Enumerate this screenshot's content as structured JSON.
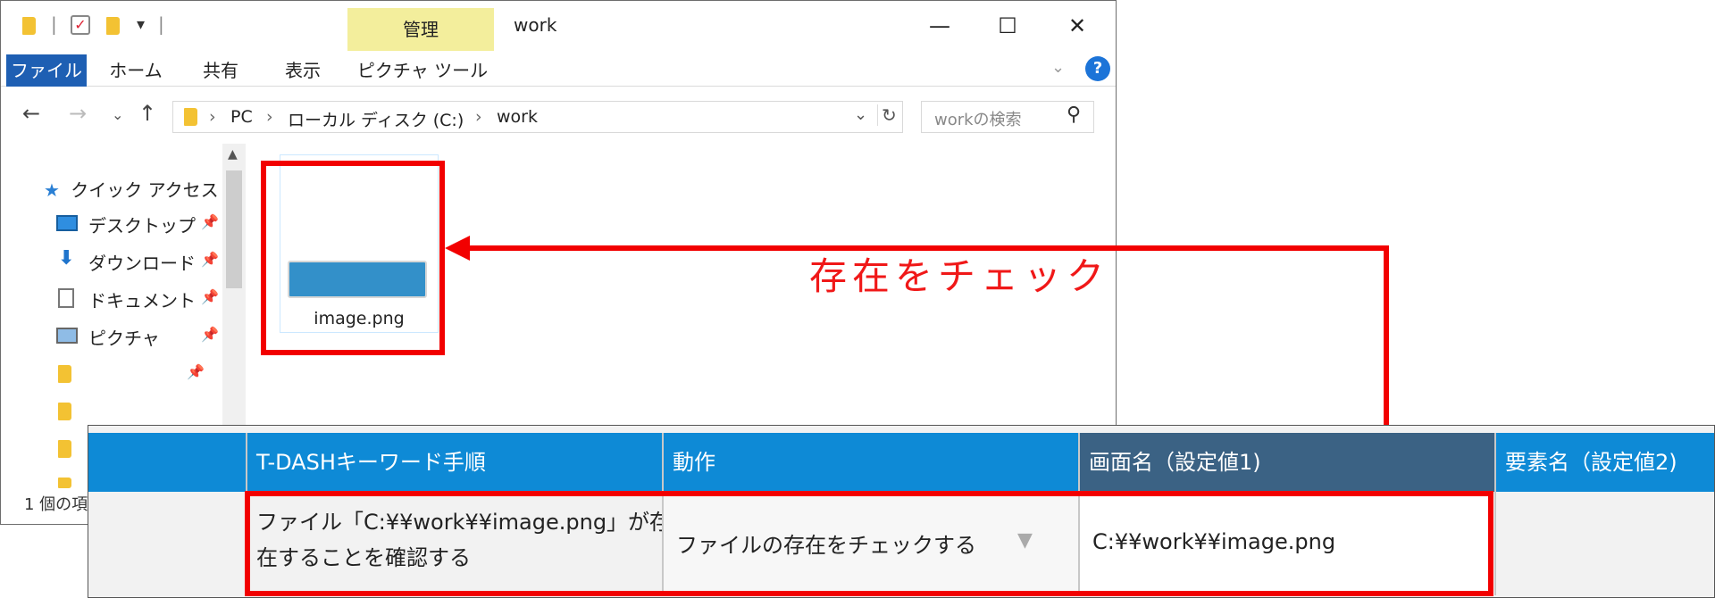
{
  "explorer": {
    "title": "work",
    "context_tab": "管理",
    "ribbon_tabs": [
      "ファイル",
      "ホーム",
      "共有",
      "表示",
      "ピクチャ ツール"
    ],
    "address": {
      "segments": [
        "PC",
        "ローカル ディスク (C:)",
        "work"
      ]
    },
    "search_placeholder": "workの検索",
    "nav": {
      "quick_access": "クイック アクセス",
      "items": [
        {
          "label": "デスクトップ",
          "icon": "desktop-icon"
        },
        {
          "label": "ダウンロード",
          "icon": "download-arrow-icon"
        },
        {
          "label": "ドキュメント",
          "icon": "document-icon"
        },
        {
          "label": "ピクチャ",
          "icon": "picture-icon"
        }
      ]
    },
    "file": {
      "name": "image.png"
    },
    "status": "1 個の項"
  },
  "annotation": {
    "label": "存在をチェック",
    "color": "#f20000"
  },
  "grid": {
    "headers": [
      "T-DASHキーワード手順",
      "動作",
      "画面名（設定値1)",
      "要素名（設定値2)"
    ],
    "row": {
      "step_line1": "ファイル「C:¥¥work¥¥image.png」が存",
      "step_line2": "在することを確認する",
      "action": "ファイルの存在をチェックする",
      "value1": "C:¥¥work¥¥image.png",
      "value2": ""
    }
  },
  "colors": {
    "header_blue": "#0e8ad6",
    "header_dark": "#3b6284",
    "accent_red": "#f20000"
  }
}
